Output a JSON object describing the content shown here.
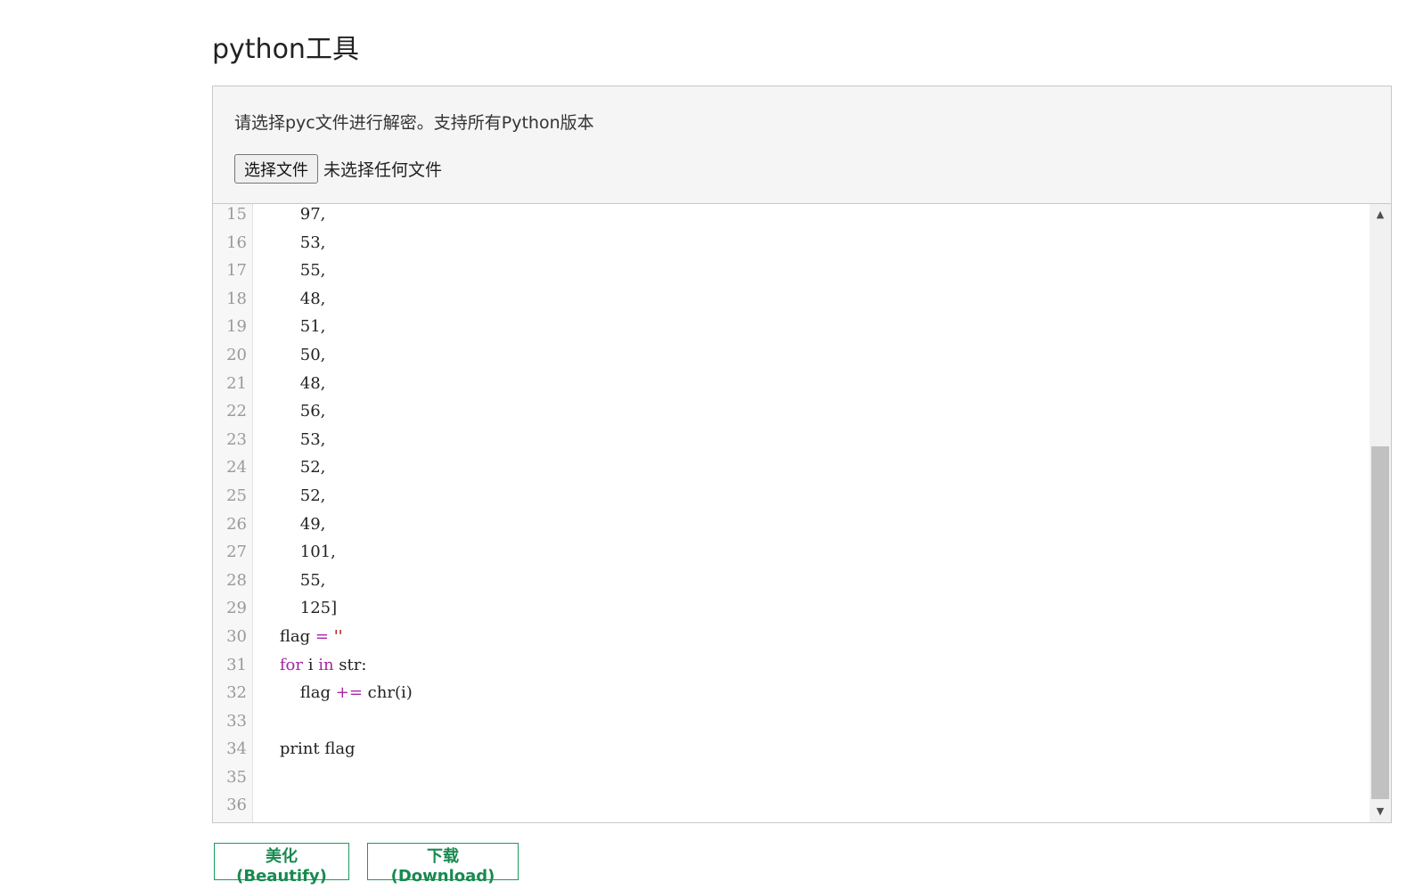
{
  "page": {
    "title": "python工具"
  },
  "panel": {
    "description": "请选择pyc文件进行解密。支持所有Python版本",
    "file_button": "选择文件",
    "file_status": "未选择任何文件"
  },
  "editor": {
    "lines": [
      {
        "n": "15",
        "text": "        97,"
      },
      {
        "n": "16",
        "text": "        53,"
      },
      {
        "n": "17",
        "text": "        55,"
      },
      {
        "n": "18",
        "text": "        48,"
      },
      {
        "n": "19",
        "text": "        51,"
      },
      {
        "n": "20",
        "text": "        50,"
      },
      {
        "n": "21",
        "text": "        48,"
      },
      {
        "n": "22",
        "text": "        56,"
      },
      {
        "n": "23",
        "text": "        53,"
      },
      {
        "n": "24",
        "text": "        52,"
      },
      {
        "n": "25",
        "text": "        52,"
      },
      {
        "n": "26",
        "text": "        49,"
      },
      {
        "n": "27",
        "text": "        101,"
      },
      {
        "n": "28",
        "text": "        55,"
      },
      {
        "n": "29",
        "text": "        125]"
      },
      {
        "n": "30",
        "text": "    flag = ''"
      },
      {
        "n": "31",
        "text": "    for i in str:"
      },
      {
        "n": "32",
        "text": "        flag += chr(i)"
      },
      {
        "n": "33",
        "text": ""
      },
      {
        "n": "34",
        "text": "    print flag"
      },
      {
        "n": "35",
        "text": ""
      },
      {
        "n": "36",
        "text": ""
      }
    ],
    "scroll_position": 0.62
  },
  "actions": {
    "beautify": "美化(Beautify)",
    "download": "下载(Download)"
  },
  "colors": {
    "accent": "#178a4f",
    "keyword": "#a626a4"
  }
}
